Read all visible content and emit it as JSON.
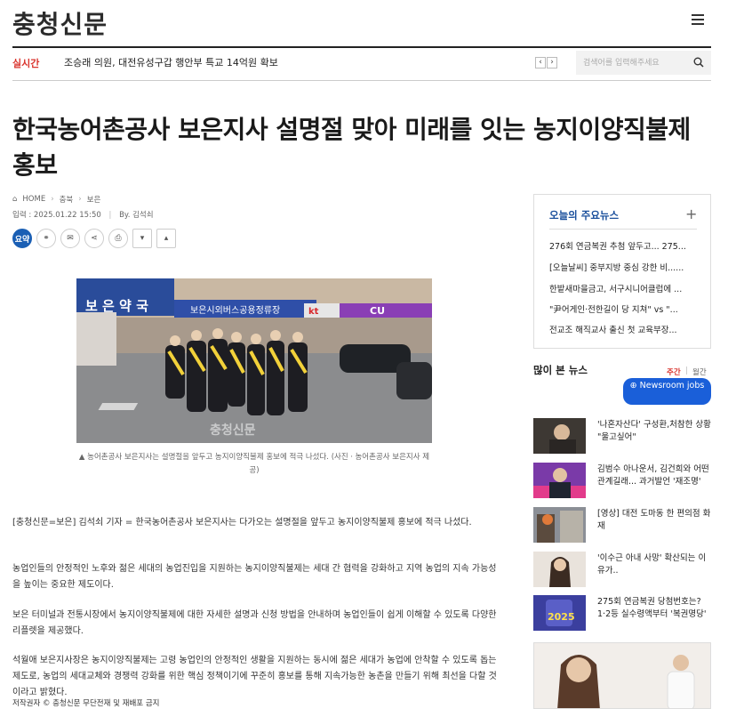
{
  "header": {
    "logo": "충청신문",
    "ticker_label": "실시간",
    "ticker_text": "조승래 의원, 대전유성구갑 행안부 특교  14억원 확보",
    "search_placeholder": "검색어를 입력해주세요"
  },
  "article": {
    "headline": "한국농어촌공사 보은지사 설명절 맞아 미래를 잇는 농지이양직불제 홍보",
    "breadcrumb": [
      "HOME",
      "충북",
      "보은"
    ],
    "date": "입력 : 2025.01.22 15:50",
    "author": "By. 김석쇠",
    "summary_button": "요약",
    "photo_signs": {
      "pharmacy": "보 은 약 국",
      "terminal": "보은시외버스공용정류장",
      "kt": "kt",
      "cu": "CU"
    },
    "photo_watermark": "충청신문",
    "caption": "▲ 농어촌공사 보은지사는 설명절을 앞두고 농지이양직불제 홍보에 적극 나섰다. (사진ㆍ농어촌공사 보은지사 제공)",
    "paragraphs": [
      "[충청신문=보은] 김석쇠 기자 = 한국농어촌공사 보은지사는 다가오는 설명절을 앞두고 농지이양직불제 홍보에 적극 나섰다.",
      "농업인들의 안정적인 노후와 젊은 세대의 농업진입을 지원하는 농지이양직불제는 세대 간 협력을 강화하고 지역 농업의 지속 가능성을 높이는 중요한 제도이다.",
      "보은 터미널과 전통시장에서 농지이양직불제에 대한 자세한 설명과 신청 방법을 안내하며 농업인들이 쉽게 이해할 수 있도록 다양한 리플렛을 제공했다.",
      "석월애 보은지사장은 농지이양직불제는 고령 농업인의 안정적인 생활을 지원하는 동시에 젊은 세대가 농업에 안착할 수 있도록 돕는 제도로, 농업의 세대교체와 경쟁력 강화를 위한 핵심 정책이기에 꾸준히 홍보를 통해 지속가능한 농촌을 만들기 위해 최선을 다할 것이라고 밝혔다."
    ],
    "copyright": "저작권자 © 충청신문 무단전재 및 재배포 금지"
  },
  "sidebar": {
    "main_news_title": "오늘의 주요뉴스",
    "main_news": [
      "276회 연금복권 추첨 앞두고... 275...",
      "[오늘날씨] 중부지방 중심 강한 비......",
      "한밭새마을금고, 서구시니어클럽에 ...",
      "\"尹어게인·전한길이 당 지쳐\" vs \"...",
      "전교조 해직교사 출신 첫 교육부장..."
    ],
    "popular_title": "많이 본 뉴스",
    "popular_tabs": [
      "주간",
      "월간"
    ],
    "newsroom_button": "Newsroom jobs",
    "popular": [
      "'나혼자산다' 구성환,처참한 상황 \"울고싶어\"",
      "김범수 아나운서, 김건희와 어떤 관계길래... 과거발언 '재조명'",
      "[영상] 대전 도마동 한 편의점 화재",
      "'이수근 아내 사망' 확산되는 이유가..",
      "275회 연금복권 당첨번호는? 1·2등 실수령액부터 '복권명당'"
    ],
    "popular_thumb_badge": "2025"
  },
  "colors": {
    "accent_blue": "#1a4f9c",
    "ticker_red": "#d9332c",
    "newsroom_blue": "#1a5fd9"
  }
}
